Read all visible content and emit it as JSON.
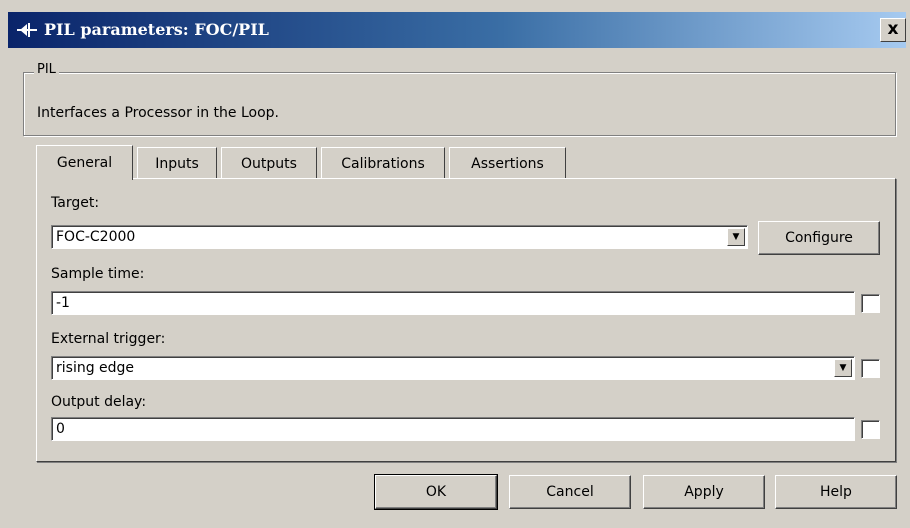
{
  "window": {
    "title": "PIL parameters: FOC/PIL",
    "close_label": "x",
    "icon": "block-icon"
  },
  "group": {
    "legend": "PIL",
    "description": "Interfaces a Processor in the Loop."
  },
  "tabs": [
    {
      "label": "General",
      "active": true
    },
    {
      "label": "Inputs",
      "active": false
    },
    {
      "label": "Outputs",
      "active": false
    },
    {
      "label": "Calibrations",
      "active": false
    },
    {
      "label": "Assertions",
      "active": false
    }
  ],
  "general": {
    "target_label": "Target:",
    "target_value": "FOC-C2000",
    "configure_label": "Configure",
    "sample_time_label": "Sample time:",
    "sample_time_value": "-1",
    "sample_time_checked": false,
    "external_trigger_label": "External trigger:",
    "external_trigger_value": "rising edge",
    "external_trigger_checked": false,
    "output_delay_label": "Output delay:",
    "output_delay_value": "0",
    "output_delay_checked": false
  },
  "buttons": {
    "ok": "OK",
    "cancel": "Cancel",
    "apply": "Apply",
    "help": "Help"
  },
  "colors": {
    "dialog_bg": "#d4d0c8",
    "title_gradient_start": "#0a246a",
    "title_gradient_end": "#a6caf0"
  }
}
